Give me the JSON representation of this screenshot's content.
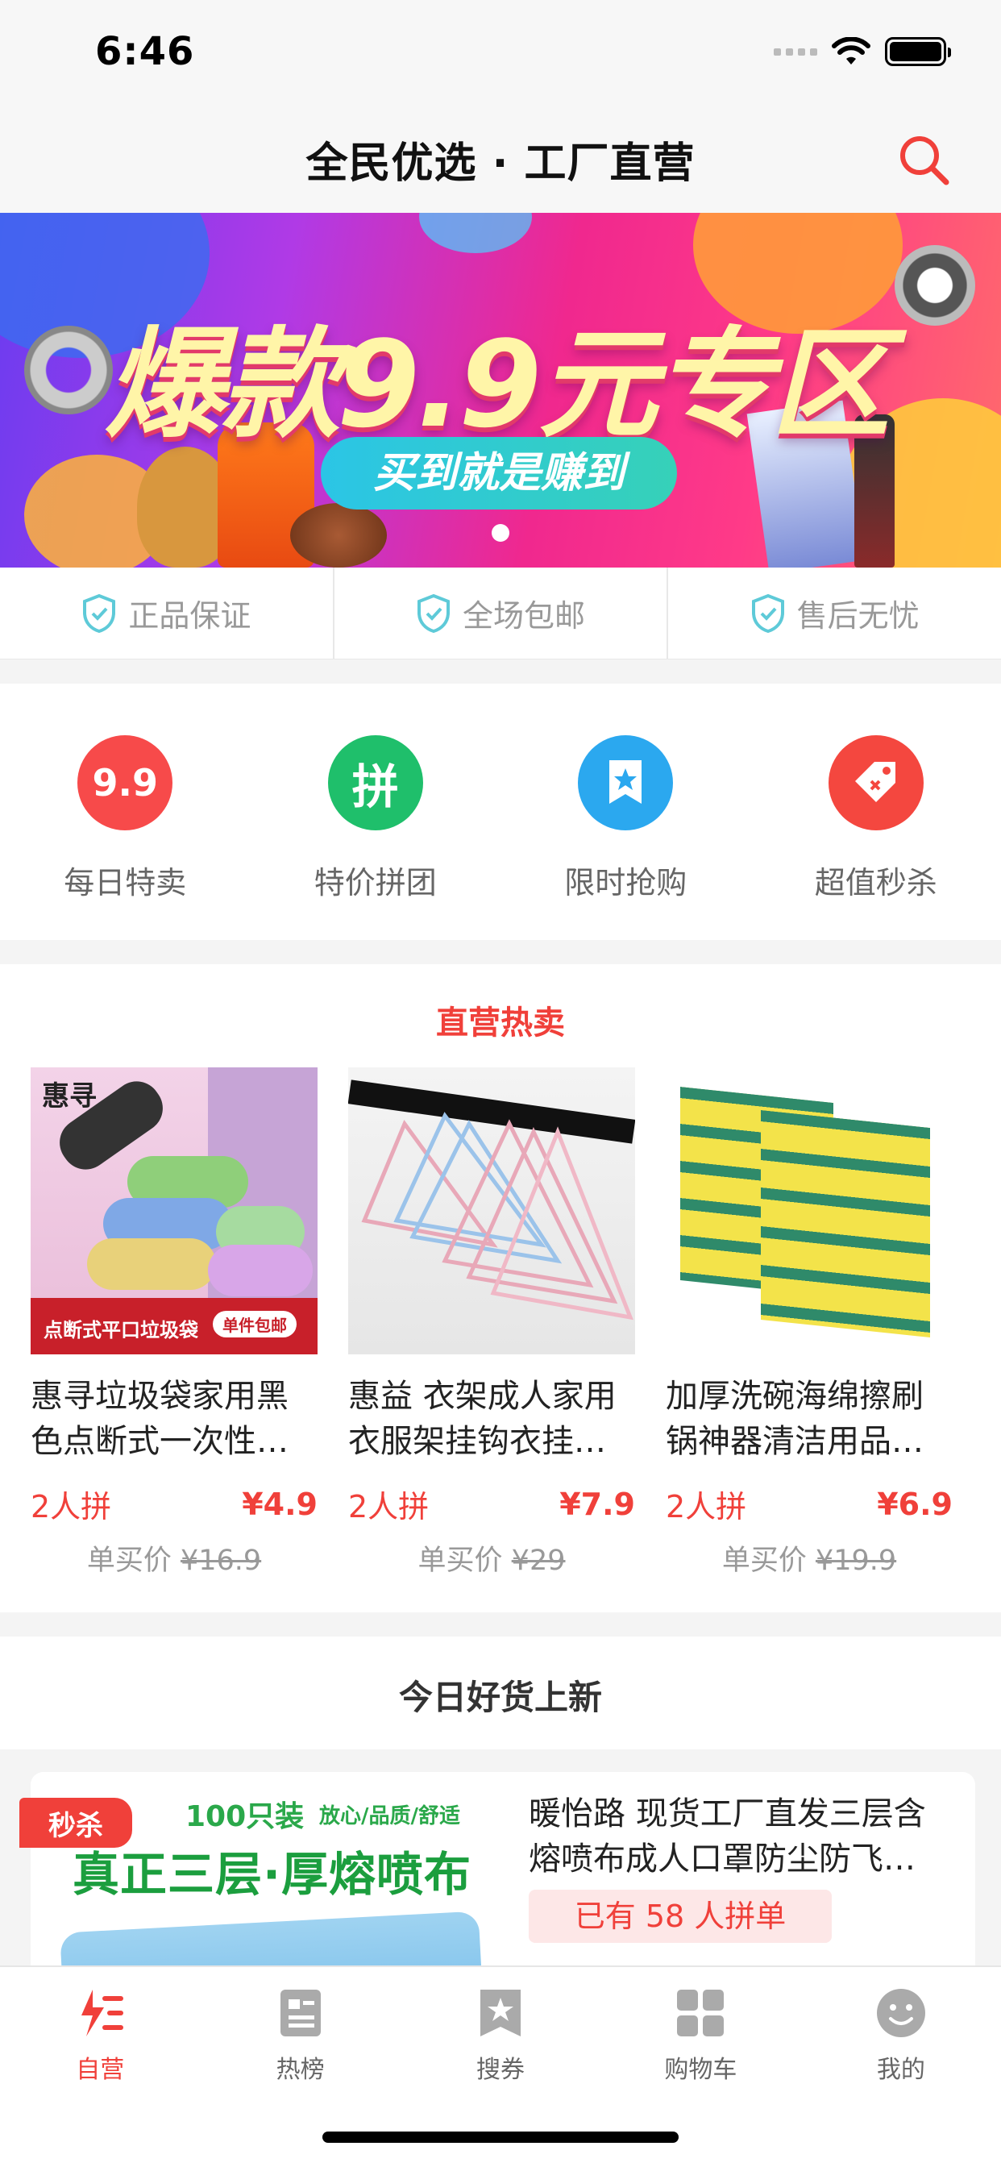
{
  "status_bar": {
    "time": "6:46"
  },
  "nav": {
    "title": "全民优选 · 工厂直营"
  },
  "banner": {
    "headline": "爆款9.9元专区",
    "subline": "买到就是赚到"
  },
  "guarantees": [
    {
      "label": "正品保证"
    },
    {
      "label": "全场包邮"
    },
    {
      "label": "售后无忧"
    }
  ],
  "categories": [
    {
      "label": "每日特卖",
      "icon_text": "9.9",
      "color": "#f74a4a"
    },
    {
      "label": "特价拼团",
      "icon_text": "拼",
      "color": "#1fbf6b"
    },
    {
      "label": "限时抢购",
      "icon_text": "",
      "color": "#2ba8ef"
    },
    {
      "label": "超值秒杀",
      "icon_text": "",
      "color": "#f4473f"
    }
  ],
  "hot": {
    "title": "直营热卖",
    "products": [
      {
        "name": "惠寻垃圾袋家用黑色点断式一次性…",
        "group": "2人拼",
        "price": "¥4.9",
        "single_label": "单买价",
        "single_price": "¥16.9",
        "img_caption": "点断式平口垃圾袋",
        "img_tag": "单件包邮",
        "img_logo": "惠寻"
      },
      {
        "name": "惠益 衣架成人家用衣服架挂钩衣挂…",
        "group": "2人拼",
        "price": "¥7.9",
        "single_label": "单买价",
        "single_price": "¥29"
      },
      {
        "name": "加厚洗碗海绵擦刷锅神器清洁用品…",
        "group": "2人拼",
        "price": "¥6.9",
        "single_label": "单买价",
        "single_price": "¥19.9"
      }
    ]
  },
  "new_today": {
    "title": "今日好货上新",
    "item": {
      "tag": "秒杀",
      "img_count": "100只装",
      "img_sub": "放心/品质/舒适",
      "img_headline": "真正三层·厚熔喷布",
      "name": "暖怡路 现货工厂直发三层含熔喷布成人口罩防尘防飞…",
      "badge": "已有 58 人拼单"
    }
  },
  "tabs": [
    {
      "label": "自营",
      "icon": "bolt-list-icon",
      "active": true
    },
    {
      "label": "热榜",
      "icon": "document-list-icon",
      "active": false
    },
    {
      "label": "搜券",
      "icon": "star-bookmark-icon",
      "active": false
    },
    {
      "label": "购物车",
      "icon": "grid-icon",
      "active": false
    },
    {
      "label": "我的",
      "icon": "smiley-face-icon",
      "active": false
    }
  ],
  "colors": {
    "accent": "#f0403a",
    "shield": "#5ecad8",
    "tab_inactive": "#aaaaaa"
  }
}
